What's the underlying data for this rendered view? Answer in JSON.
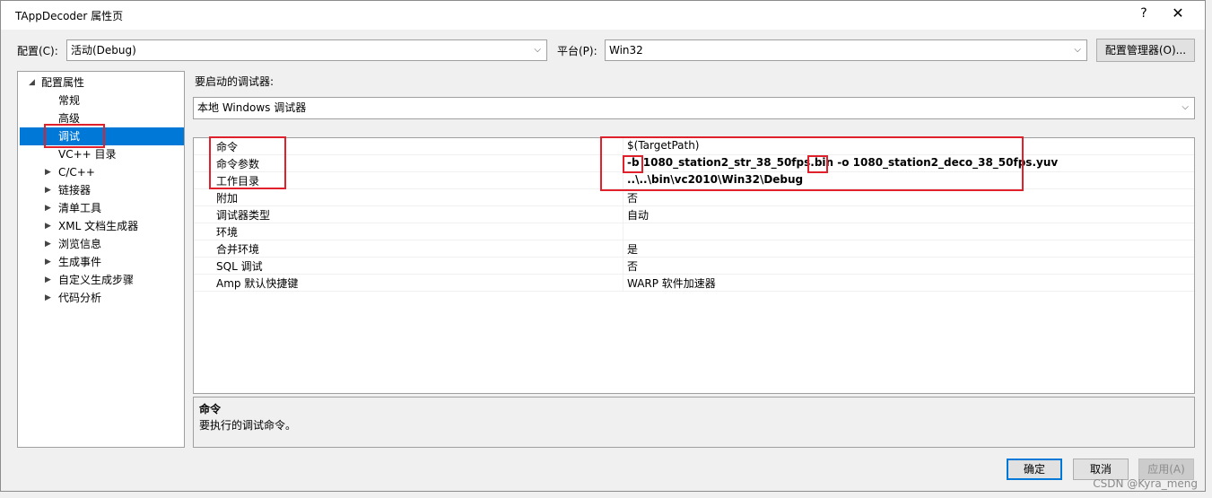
{
  "window": {
    "title": "TAppDecoder 属性页",
    "help": "?",
    "close": "✕"
  },
  "toolbar": {
    "config_label": "配置(C):",
    "config_value": "活动(Debug)",
    "platform_label": "平台(P):",
    "platform_value": "Win32",
    "config_manager": "配置管理器(O)..."
  },
  "tree": {
    "root": "配置属性",
    "items": [
      {
        "label": "常规",
        "expandable": false
      },
      {
        "label": "高级",
        "expandable": false
      },
      {
        "label": "调试",
        "expandable": false,
        "selected": true
      },
      {
        "label": "VC++ 目录",
        "expandable": false
      },
      {
        "label": "C/C++",
        "expandable": true
      },
      {
        "label": "链接器",
        "expandable": true
      },
      {
        "label": "清单工具",
        "expandable": true
      },
      {
        "label": "XML 文档生成器",
        "expandable": true
      },
      {
        "label": "浏览信息",
        "expandable": true
      },
      {
        "label": "生成事件",
        "expandable": true
      },
      {
        "label": "自定义生成步骤",
        "expandable": true
      },
      {
        "label": "代码分析",
        "expandable": true
      }
    ]
  },
  "debugger": {
    "label": "要启动的调试器:",
    "value": "本地 Windows 调试器"
  },
  "properties": [
    {
      "key": "命令",
      "value": "$(TargetPath)",
      "bold": false
    },
    {
      "key": "命令参数",
      "value": "-b 1080_station2_str_38_50fps.bin -o 1080_station2_deco_38_50fps.yuv",
      "bold": true
    },
    {
      "key": "工作目录",
      "value": "..\\..\\bin\\vc2010\\Win32\\Debug",
      "bold": true
    },
    {
      "key": "附加",
      "value": "否",
      "bold": false
    },
    {
      "key": "调试器类型",
      "value": "自动",
      "bold": false
    },
    {
      "key": "环境",
      "value": "",
      "bold": false
    },
    {
      "key": "合并环境",
      "value": "是",
      "bold": false
    },
    {
      "key": "SQL 调试",
      "value": "否",
      "bold": false
    },
    {
      "key": "Amp 默认快捷键",
      "value": "WARP 软件加速器",
      "bold": false
    }
  ],
  "description": {
    "title": "命令",
    "text": "要执行的调试命令。"
  },
  "buttons": {
    "ok": "确定",
    "cancel": "取消",
    "apply": "应用(A)"
  },
  "watermark": "CSDN @Kyra_meng",
  "colors": {
    "selection": "#0078d7",
    "highlight": "#e0202a"
  }
}
